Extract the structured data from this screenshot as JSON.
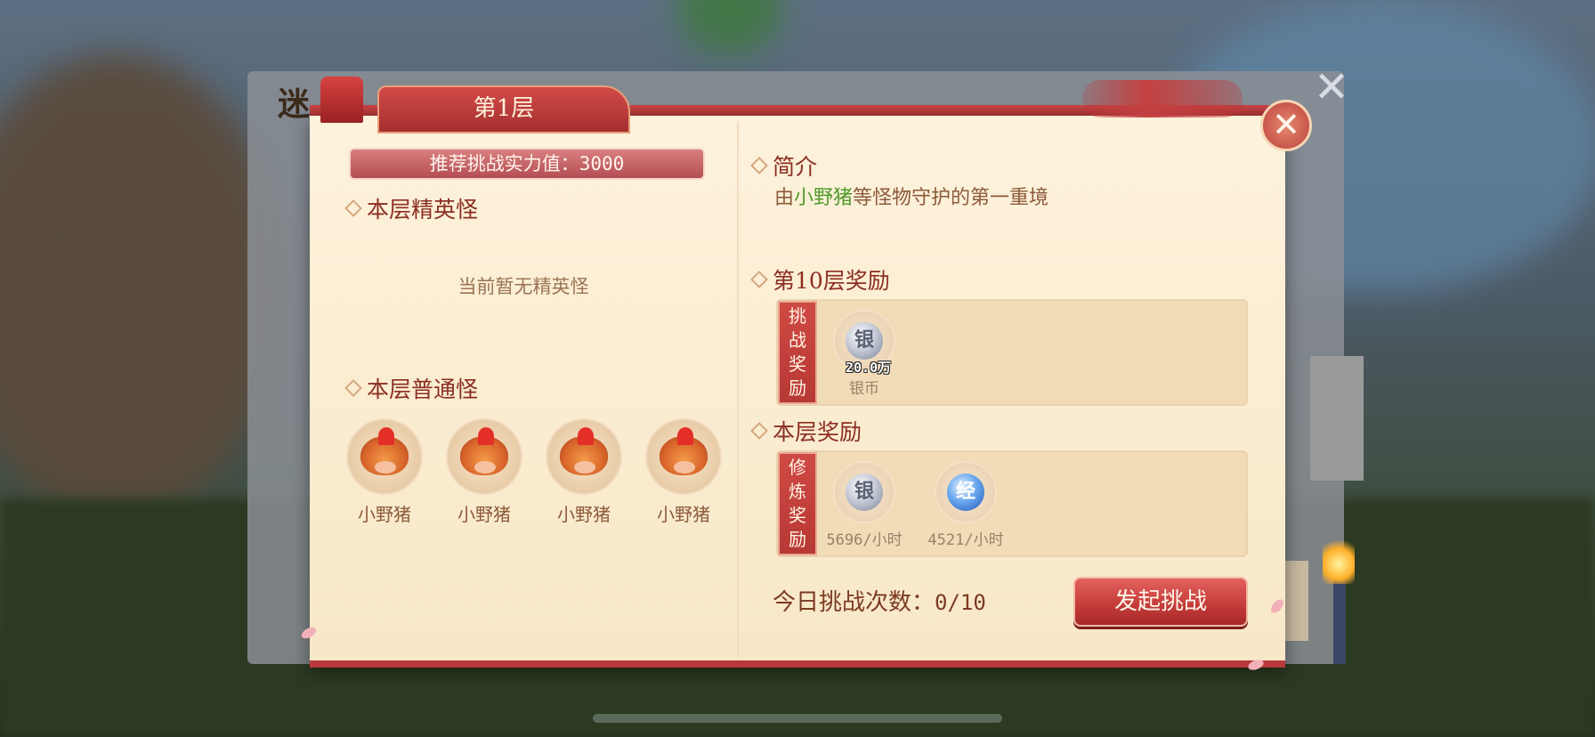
{
  "background": {
    "title": "迷",
    "close_label": "✕"
  },
  "dialog": {
    "tab_title": "第1层",
    "close_label": "✕",
    "recommend_power": {
      "label": "推荐挑战实力值：",
      "value": "3000"
    },
    "elite_section": {
      "title": "本层精英怪",
      "empty_text": "当前暂无精英怪"
    },
    "normal_section": {
      "title": "本层普通怪",
      "monsters": [
        {
          "name": "小野猪",
          "icon": "boar-icon"
        },
        {
          "name": "小野猪",
          "icon": "boar-icon"
        },
        {
          "name": "小野猪",
          "icon": "boar-icon"
        },
        {
          "name": "小野猪",
          "icon": "boar-icon"
        }
      ]
    },
    "intro": {
      "title": "简介",
      "prefix": "由",
      "highlight": "小野猪",
      "suffix": "等怪物守护的第一重境",
      "highlight_color": "#4e9a2a"
    },
    "floor10_reward": {
      "title": "第10层奖励",
      "tag_chars": [
        "挑",
        "战",
        "奖",
        "励"
      ],
      "items": [
        {
          "icon": "silver-coin-icon",
          "glyph": "银",
          "amount": "20.0万",
          "name": "银币"
        }
      ]
    },
    "floor_reward": {
      "title": "本层奖励",
      "tag_chars": [
        "修",
        "炼",
        "奖",
        "励"
      ],
      "items": [
        {
          "icon": "silver-coin-icon",
          "glyph": "银",
          "rate": "5696/小时"
        },
        {
          "icon": "exp-icon",
          "glyph": "经",
          "rate": "4521/小时"
        }
      ]
    },
    "daily_challenges": {
      "label": "今日挑战次数：",
      "value": "0/10"
    },
    "challenge_button": "发起挑战"
  },
  "colors": {
    "accent_red": "#c33a38",
    "panel_bg": "#fdf2dc",
    "header_text": "#8c2e22"
  }
}
